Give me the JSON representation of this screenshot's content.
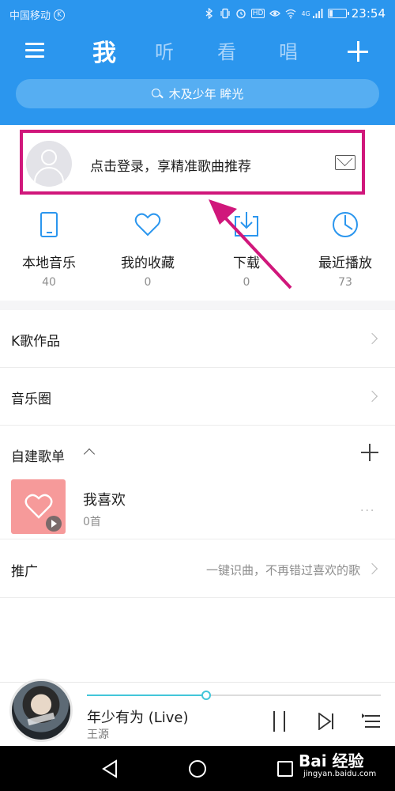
{
  "status_bar": {
    "carrier": "中国移动",
    "carrier_badge": "K",
    "hd_badge": "HD",
    "network": "4G",
    "time": "23:54"
  },
  "nav": {
    "menu_icon": "hamburger-icon",
    "tabs": [
      {
        "label": "我",
        "active": true
      },
      {
        "label": "听",
        "active": false
      },
      {
        "label": "看",
        "active": false
      },
      {
        "label": "唱",
        "active": false
      }
    ],
    "add_icon": "plus-icon"
  },
  "search": {
    "placeholder": "木及少年 眸光"
  },
  "login": {
    "prompt": "点击登录，享精准歌曲推荐",
    "highlight_color": "#d0177b"
  },
  "quick_items": [
    {
      "label": "本地音乐",
      "count": "40",
      "icon": "phone-icon"
    },
    {
      "label": "我的收藏",
      "count": "0",
      "icon": "heart-icon"
    },
    {
      "label": "下载",
      "count": "0",
      "icon": "download-icon"
    },
    {
      "label": "最近播放",
      "count": "73",
      "icon": "clock-icon"
    }
  ],
  "list": {
    "k_works": "K歌作品",
    "music_circle": "音乐圈",
    "my_playlists": "自建歌单"
  },
  "playlist": {
    "title": "我喜欢",
    "count": "0首",
    "more": "···"
  },
  "promo": {
    "label": "推广",
    "text": "一键识曲，不再错过喜欢的歌"
  },
  "player": {
    "song": "年少有为 (Live)",
    "artist": "王源",
    "progress": 0.405
  },
  "watermark": {
    "logo": "Bai 经验",
    "site": "jingyan.baidu.com"
  },
  "colors": {
    "accent": "#2b96ee",
    "progress": "#43c6d9",
    "annotation": "#d0177b"
  }
}
